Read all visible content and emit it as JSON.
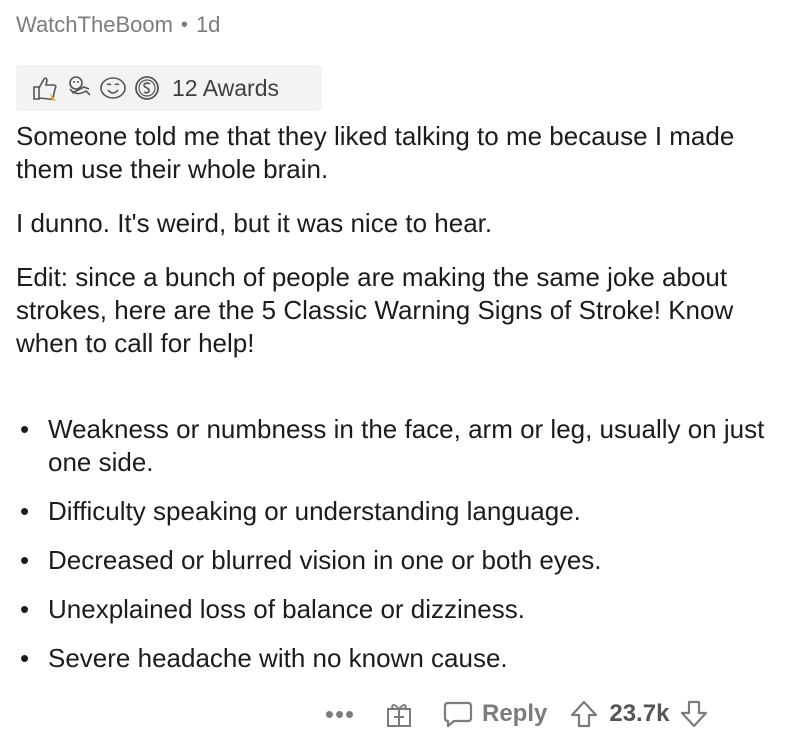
{
  "comment": {
    "author": "WatchTheBoom",
    "separator": "•",
    "age": "1d",
    "awards_label": "12 Awards",
    "paragraphs": [
      "Someone told me that they liked talking to me because I made them use their whole brain.",
      "I dunno. It's weird, but it was nice to hear.",
      "Edit: since a bunch of people are making the same joke about strokes, here are the 5 Classic Warning Signs of Stroke! Know when to call for help!"
    ],
    "list_items": [
      "Weakness or numbness in the face, arm or leg, usually on just one side.",
      "Difficulty speaking or understanding language.",
      "Decreased or blurred vision in one or both eyes.",
      "Unexplained loss of balance or dizziness.",
      "Severe headache with no known cause."
    ],
    "bullet": "•"
  },
  "actions": {
    "more": "•••",
    "reply_label": "Reply",
    "score": "23.7k",
    "icons": [
      "more-options-icon",
      "gift-icon",
      "chat-bubble-icon",
      "upvote-arrow-icon",
      "downvote-arrow-icon"
    ]
  },
  "awards_icons": [
    "wholesome-award-icon",
    "hugz-award-icon",
    "laughing-face-award-icon",
    "silver-coin-award-icon"
  ]
}
